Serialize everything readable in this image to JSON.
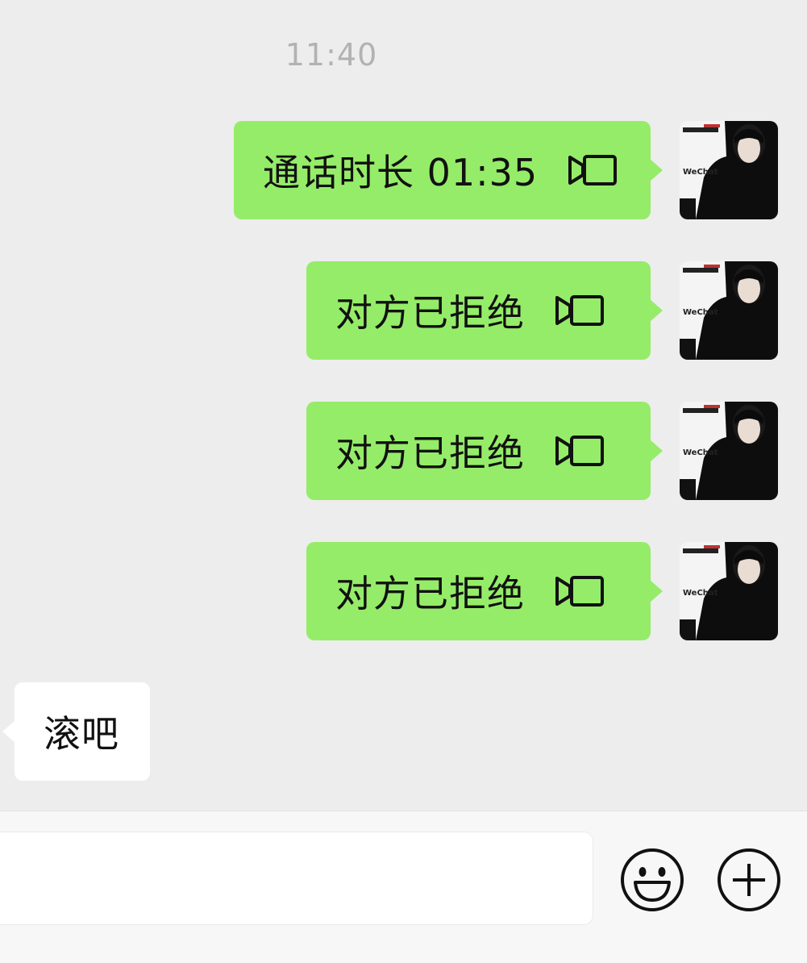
{
  "chat": {
    "timestamp": "11:40",
    "outgoing": [
      {
        "text": "通话时长 01:35",
        "icon": "video-call-icon"
      },
      {
        "text": "对方已拒绝",
        "icon": "video-call-icon"
      },
      {
        "text": "对方已拒绝",
        "icon": "video-call-icon"
      },
      {
        "text": "对方已拒绝",
        "icon": "video-call-icon"
      }
    ],
    "incoming": [
      {
        "text": "滚吧"
      }
    ],
    "avatar_text": "WeChat"
  },
  "input_bar": {
    "placeholder": "",
    "emoji_icon": "smiley-icon",
    "more_icon": "plus-circle-icon"
  },
  "colors": {
    "background": "#EDEDED",
    "outgoing_bubble": "#95EC69",
    "incoming_bubble": "#FFFFFF",
    "timestamp": "#B2B2B2"
  }
}
